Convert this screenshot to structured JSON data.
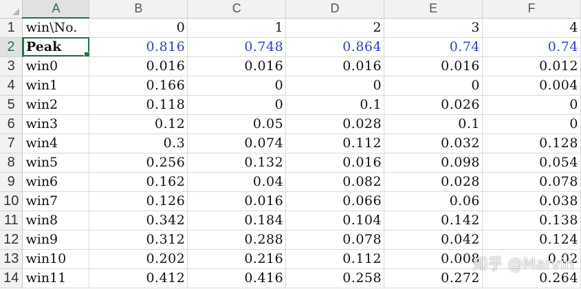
{
  "columns": [
    "A",
    "B",
    "C",
    "D",
    "E",
    "F"
  ],
  "selected_cell": "A2",
  "rows": [
    {
      "num": "1",
      "label": "win\\No.",
      "values": [
        "0",
        "1",
        "2",
        "3",
        "4"
      ]
    },
    {
      "num": "2",
      "label": "Peak",
      "values": [
        "0.816",
        "0.748",
        "0.864",
        "0.74",
        "0.74"
      ]
    },
    {
      "num": "3",
      "label": "win0",
      "values": [
        "0.016",
        "0.016",
        "0.016",
        "0.016",
        "0.012"
      ]
    },
    {
      "num": "4",
      "label": "win1",
      "values": [
        "0.166",
        "0",
        "0",
        "0",
        "0.004"
      ]
    },
    {
      "num": "5",
      "label": "win2",
      "values": [
        "0.118",
        "0",
        "0.1",
        "0.026",
        "0"
      ]
    },
    {
      "num": "6",
      "label": "win3",
      "values": [
        "0.12",
        "0.05",
        "0.028",
        "0.1",
        "0"
      ]
    },
    {
      "num": "7",
      "label": "win4",
      "values": [
        "0.3",
        "0.074",
        "0.112",
        "0.032",
        "0.128"
      ]
    },
    {
      "num": "8",
      "label": "win5",
      "values": [
        "0.256",
        "0.132",
        "0.016",
        "0.098",
        "0.054"
      ]
    },
    {
      "num": "9",
      "label": "win6",
      "values": [
        "0.162",
        "0.04",
        "0.082",
        "0.028",
        "0.078"
      ]
    },
    {
      "num": "10",
      "label": "win7",
      "values": [
        "0.126",
        "0.016",
        "0.066",
        "0.06",
        "0.038"
      ]
    },
    {
      "num": "11",
      "label": "win8",
      "values": [
        "0.342",
        "0.184",
        "0.104",
        "0.142",
        "0.138"
      ]
    },
    {
      "num": "12",
      "label": "win9",
      "values": [
        "0.312",
        "0.288",
        "0.078",
        "0.042",
        "0.124"
      ]
    },
    {
      "num": "13",
      "label": "win10",
      "values": [
        "0.202",
        "0.216",
        "0.112",
        "0.008",
        "0.02"
      ]
    },
    {
      "num": "14",
      "label": "win11",
      "values": [
        "0.412",
        "0.416",
        "0.258",
        "0.272",
        "0.264"
      ]
    }
  ],
  "watermark": "知乎 @Marvin",
  "colors": {
    "peak_values": "#2d3fc4",
    "selection": "#217346"
  }
}
